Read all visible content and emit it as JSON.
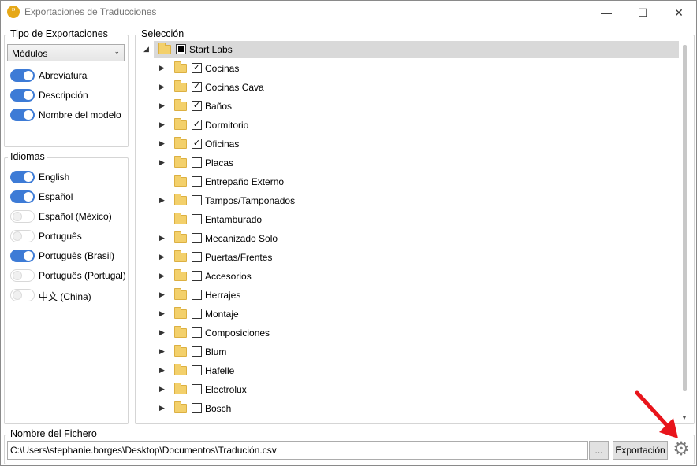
{
  "window": {
    "title": "Exportaciones de Traducciones",
    "app_icon": "quote-icon",
    "app_icon_glyph": "”",
    "minimize_glyph": "—",
    "maximize_glyph": "☐",
    "close_glyph": "✕"
  },
  "export_type": {
    "title": "Tipo de Exportaciones",
    "dropdown_value": "Módulos",
    "options": [
      {
        "label": "Abreviatura",
        "on": true
      },
      {
        "label": "Descripción",
        "on": true
      },
      {
        "label": "Nombre del modelo",
        "on": true
      }
    ]
  },
  "languages": {
    "title": "Idiomas",
    "items": [
      {
        "label": "English",
        "on": true
      },
      {
        "label": "Español",
        "on": true
      },
      {
        "label": "Español (México)",
        "on": false
      },
      {
        "label": "Português",
        "on": false
      },
      {
        "label": "Português (Brasil)",
        "on": true
      },
      {
        "label": "Português (Portugal)",
        "on": false
      },
      {
        "label": "中文 (China)",
        "on": false
      }
    ]
  },
  "selection": {
    "title": "Selección",
    "root": {
      "label": "Start Labs",
      "state": "partial",
      "expanded": true
    },
    "children": [
      {
        "label": "Cocinas",
        "checked": true,
        "has_children": true
      },
      {
        "label": "Cocinas Cava",
        "checked": true,
        "has_children": true
      },
      {
        "label": "Baños",
        "checked": true,
        "has_children": true
      },
      {
        "label": "Dormitorio",
        "checked": true,
        "has_children": true
      },
      {
        "label": "Oficinas",
        "checked": true,
        "has_children": true
      },
      {
        "label": "Placas",
        "checked": false,
        "has_children": true
      },
      {
        "label": "Entrepaño Externo",
        "checked": false,
        "has_children": false
      },
      {
        "label": "Tampos/Tamponados",
        "checked": false,
        "has_children": true
      },
      {
        "label": "Entamburado",
        "checked": false,
        "has_children": false
      },
      {
        "label": "Mecanizado Solo",
        "checked": false,
        "has_children": true
      },
      {
        "label": "Puertas/Frentes",
        "checked": false,
        "has_children": true
      },
      {
        "label": "Accesorios",
        "checked": false,
        "has_children": true
      },
      {
        "label": "Herrajes",
        "checked": false,
        "has_children": true
      },
      {
        "label": "Montaje",
        "checked": false,
        "has_children": true
      },
      {
        "label": "Composiciones",
        "checked": false,
        "has_children": true
      },
      {
        "label": "Blum",
        "checked": false,
        "has_children": true
      },
      {
        "label": "Hafelle",
        "checked": false,
        "has_children": true
      },
      {
        "label": "Electrolux",
        "checked": false,
        "has_children": true
      },
      {
        "label": "Bosch",
        "checked": false,
        "has_children": true
      }
    ]
  },
  "file": {
    "title": "Nombre del Fichero",
    "path": "C:\\Users\\stephanie.borges\\Desktop\\Documentos\\Tradución.csv",
    "browse_label": "...",
    "export_label": "Exportación",
    "settings_icon": "gear-icon",
    "settings_glyph": "⚙"
  },
  "colors": {
    "toggle_on": "#3d7bd6",
    "annotation_arrow": "#e8141b",
    "selected_row": "#d9d9d9"
  }
}
